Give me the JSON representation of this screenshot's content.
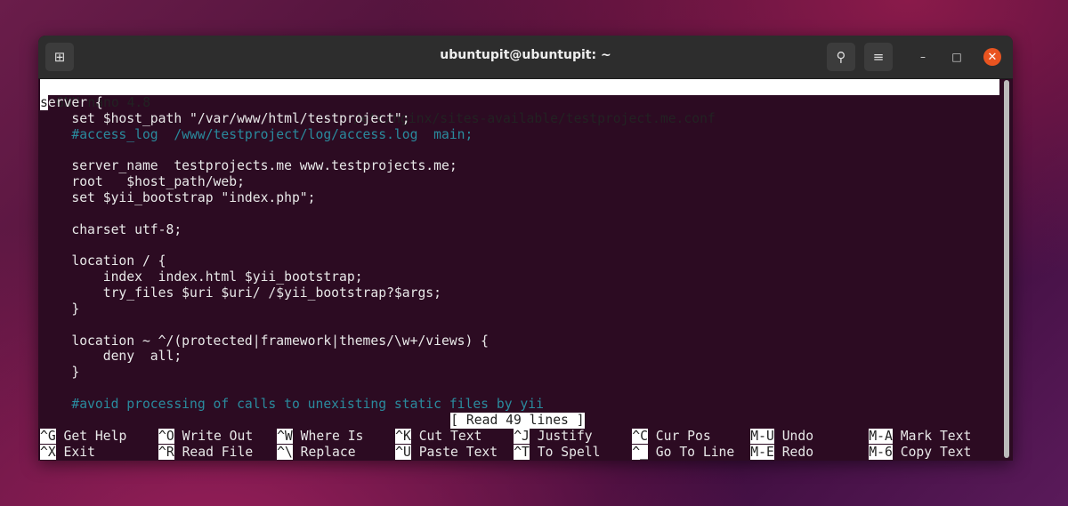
{
  "window": {
    "title": "ubuntupit@ubuntupit: ~"
  },
  "icons": {
    "new_tab": "new-tab-icon",
    "search": "search-icon",
    "menu": "hamburger-menu-icon",
    "minimize": "minimize-icon",
    "maximize": "maximize-icon",
    "close": "close-icon"
  },
  "colors": {
    "terminal_bg": "#2c0b22",
    "comment": "#2aa1b3",
    "close_button": "#e95420"
  },
  "nano": {
    "version": "GNU nano 4.8",
    "filename": "/etc/nginx/sites-available/testproject.me.conf",
    "status": "[ Read 49 lines ]",
    "lines": [
      {
        "text": "server {",
        "comment": false
      },
      {
        "text": "    set $host_path \"/var/www/html/testproject\";",
        "comment": false
      },
      {
        "text": "    #access_log  /www/testproject/log/access.log  main;",
        "comment": true
      },
      {
        "text": "",
        "comment": false
      },
      {
        "text": "    server_name  testprojects.me www.testprojects.me;",
        "comment": false
      },
      {
        "text": "    root   $host_path/web;",
        "comment": false
      },
      {
        "text": "    set $yii_bootstrap \"index.php\";",
        "comment": false
      },
      {
        "text": "",
        "comment": false
      },
      {
        "text": "    charset utf-8;",
        "comment": false
      },
      {
        "text": "",
        "comment": false
      },
      {
        "text": "    location / {",
        "comment": false
      },
      {
        "text": "        index  index.html $yii_bootstrap;",
        "comment": false
      },
      {
        "text": "        try_files $uri $uri/ /$yii_bootstrap?$args;",
        "comment": false
      },
      {
        "text": "    }",
        "comment": false
      },
      {
        "text": "",
        "comment": false
      },
      {
        "text": "    location ~ ^/(protected|framework|themes/\\w+/views) {",
        "comment": false
      },
      {
        "text": "        deny  all;",
        "comment": false
      },
      {
        "text": "    }",
        "comment": false
      },
      {
        "text": "",
        "comment": false
      },
      {
        "text": "    #avoid processing of calls to unexisting static files by yii",
        "comment": true
      }
    ],
    "shortcuts": [
      [
        {
          "key": "^G",
          "label": "Get Help"
        },
        {
          "key": "^O",
          "label": "Write Out"
        },
        {
          "key": "^W",
          "label": "Where Is"
        },
        {
          "key": "^K",
          "label": "Cut Text"
        },
        {
          "key": "^J",
          "label": "Justify"
        },
        {
          "key": "^C",
          "label": "Cur Pos"
        },
        {
          "key": "M-U",
          "label": "Undo"
        },
        {
          "key": "M-A",
          "label": "Mark Text"
        }
      ],
      [
        {
          "key": "^X",
          "label": "Exit"
        },
        {
          "key": "^R",
          "label": "Read File"
        },
        {
          "key": "^\\",
          "label": "Replace"
        },
        {
          "key": "^U",
          "label": "Paste Text"
        },
        {
          "key": "^T",
          "label": "To Spell"
        },
        {
          "key": "^_",
          "label": "Go To Line"
        },
        {
          "key": "M-E",
          "label": "Redo"
        },
        {
          "key": "M-6",
          "label": "Copy Text"
        }
      ]
    ]
  }
}
